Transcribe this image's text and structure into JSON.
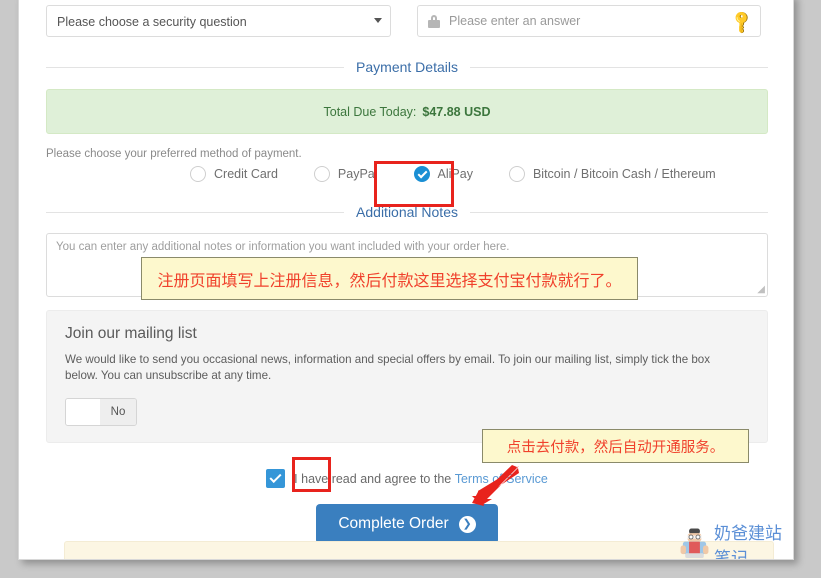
{
  "security": {
    "question_selected": "Please choose a security question",
    "answer_placeholder": "Please enter an answer"
  },
  "payment_details": {
    "heading": "Payment Details",
    "total_label": "Total Due Today:",
    "total_amount": "$47.88 USD",
    "method_label": "Please choose your preferred method of payment.",
    "methods": [
      {
        "label": "Credit Card",
        "selected": false
      },
      {
        "label": "PayPal",
        "selected": false
      },
      {
        "label": "AliPay",
        "selected": true
      },
      {
        "label": "Bitcoin / Bitcoin Cash / Ethereum",
        "selected": false
      }
    ]
  },
  "additional_notes": {
    "heading": "Additional Notes",
    "placeholder": "You can enter any additional notes or information you want included with your order here."
  },
  "mailing_list": {
    "title": "Join our mailing list",
    "description": "We would like to send you occasional news, information and special offers by email. To join our mailing list, simply tick the box below. You can unsubscribe at any time.",
    "toggle_value": "No"
  },
  "agreement": {
    "checked": true,
    "text": "I have read and agree to the",
    "link_text": "Terms of Service"
  },
  "submit": {
    "label": "Complete Order",
    "arrow_glyph": "❯"
  },
  "annotations": [
    {
      "id": "notes-annotation",
      "text": "注册页面填写上注册信息，然后付款这里选择支付宝付款就行了。"
    },
    {
      "id": "pay-annotation",
      "text": "点击去付款，然后自动开通服务。"
    }
  ],
  "watermark": {
    "text": "奶爸建站笔记"
  },
  "colors": {
    "accent_blue": "#3a7fbf",
    "radio_selected": "#1a8fd4",
    "highlight_red": "#e8231d",
    "annotation_bg": "#fdf8cd",
    "annotation_text": "#f0412c",
    "success_bg": "#dff0d8",
    "success_text": "#3c763d",
    "link_blue": "#5a9ad4"
  }
}
